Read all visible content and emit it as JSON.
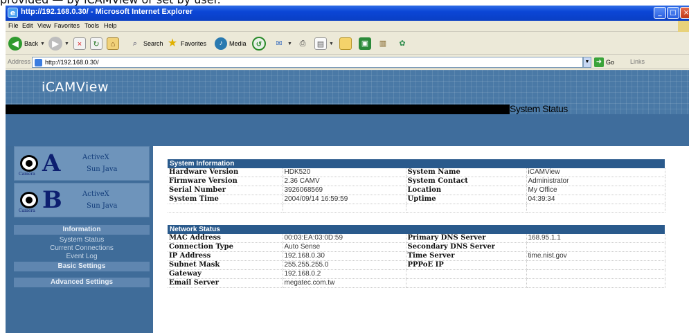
{
  "caption": "provided — by iCAMView or set by user.",
  "window": {
    "title": "http://192.168.0.30/ - Microsoft Internet Explorer"
  },
  "menu": [
    "File",
    "Edit",
    "View",
    "Favorites",
    "Tools",
    "Help"
  ],
  "toolbar": {
    "back": "Back",
    "search": "Search",
    "favorites": "Favorites",
    "media": "Media"
  },
  "address": {
    "label": "Address",
    "url": "http://192.168.0.30/",
    "go": "Go",
    "links": "Links"
  },
  "header": {
    "brand": "iCAMView",
    "section_title": "System Status"
  },
  "sidebar": {
    "camera_a": {
      "letter": "A",
      "caption": "Camera",
      "activex": "ActiveX",
      "sunjava": "Sun Java"
    },
    "camera_b": {
      "letter": "B",
      "caption": "Camera",
      "activex": "ActiveX",
      "sunjava": "Sun Java"
    },
    "information": "Information",
    "links": [
      "System Status",
      "Current Connections",
      "Event Log"
    ],
    "basic_settings": "Basic Settings",
    "advanced_settings": "Advanced Settings"
  },
  "system_information": {
    "title": "System Information",
    "rows": [
      {
        "k1": "Hardware Version",
        "v1": "HDK520",
        "k2": "System Name",
        "v2": "iCAMView"
      },
      {
        "k1": "Firmware Version",
        "v1": "2.36 CAMV",
        "k2": "System Contact",
        "v2": "Administrator"
      },
      {
        "k1": "Serial Number",
        "v1": "3926068569",
        "k2": "Location",
        "v2": "My Office"
      },
      {
        "k1": "System Time",
        "v1": "2004/09/14 16:59:59",
        "k2": "Uptime",
        "v2": "04:39:34"
      }
    ]
  },
  "network_status": {
    "title": "Network Status",
    "rows": [
      {
        "k1": "MAC Address",
        "v1": "00:03:EA:03:0D:59",
        "k2": "Primary DNS Server",
        "v2": "168.95.1.1"
      },
      {
        "k1": "Connection Type",
        "v1": "Auto Sense",
        "k2": "Secondary DNS Server",
        "v2": ""
      },
      {
        "k1": "IP Address",
        "v1": "192.168.0.30",
        "k2": "Time Server",
        "v2": "time.nist.gov"
      },
      {
        "k1": "Subnet Mask",
        "v1": "255.255.255.0",
        "k2": "PPPoE IP",
        "v2": ""
      },
      {
        "k1": "Gateway",
        "v1": "192.168.0.2",
        "k2": "",
        "v2": ""
      },
      {
        "k1": "Email Server",
        "v1": "megatec.com.tw",
        "k2": "",
        "v2": ""
      }
    ]
  }
}
